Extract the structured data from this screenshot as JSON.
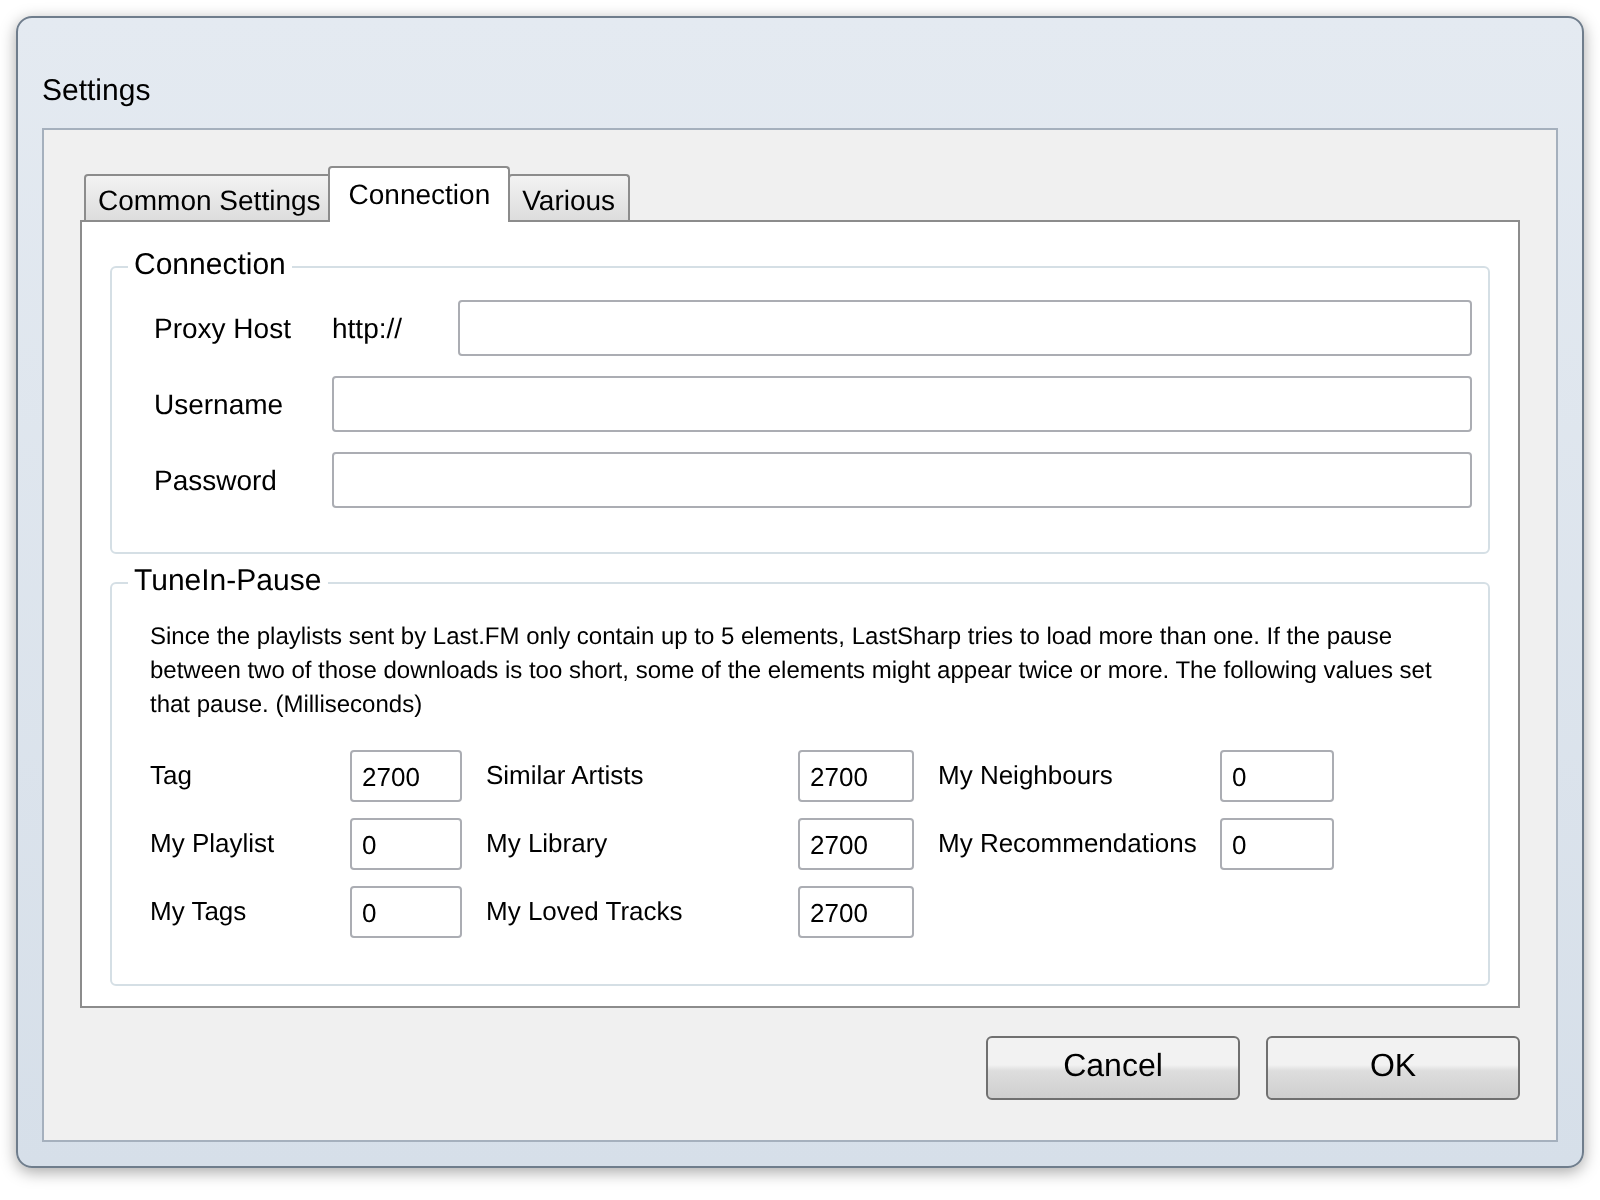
{
  "window": {
    "title": "Settings"
  },
  "tabs": [
    {
      "label": "Common Settings",
      "selected": false
    },
    {
      "label": "Connection",
      "selected": true
    },
    {
      "label": "Various",
      "selected": false
    }
  ],
  "connection": {
    "title": "Connection",
    "fields": [
      {
        "label": "Proxy Host",
        "prefix": "http://"
      },
      {
        "label": "Username"
      },
      {
        "label": "Password"
      }
    ]
  },
  "tunein_pause": {
    "title": "TuneIn-Pause",
    "description": "Since the playlists sent by Last.FM only contain up to 5 elements, LastSharp tries to load more than one. If the pause between two of those downloads is too short, some of the elements might appear twice or more. The following values set that pause. (Milliseconds)",
    "fields": [
      {
        "label": "Tag",
        "value": "2700"
      },
      {
        "label": "Similar Artists",
        "value": "2700"
      },
      {
        "label": "My Neighbours",
        "value": "0"
      },
      {
        "label": "My Playlist",
        "value": "0"
      },
      {
        "label": "My Library",
        "value": "2700"
      },
      {
        "label": "My Recommendations",
        "value": "0"
      },
      {
        "label": "My Tags",
        "value": "0"
      },
      {
        "label": "My Loved Tracks",
        "value": "2700"
      }
    ]
  },
  "buttons": [
    "Cancel",
    "OK"
  ]
}
